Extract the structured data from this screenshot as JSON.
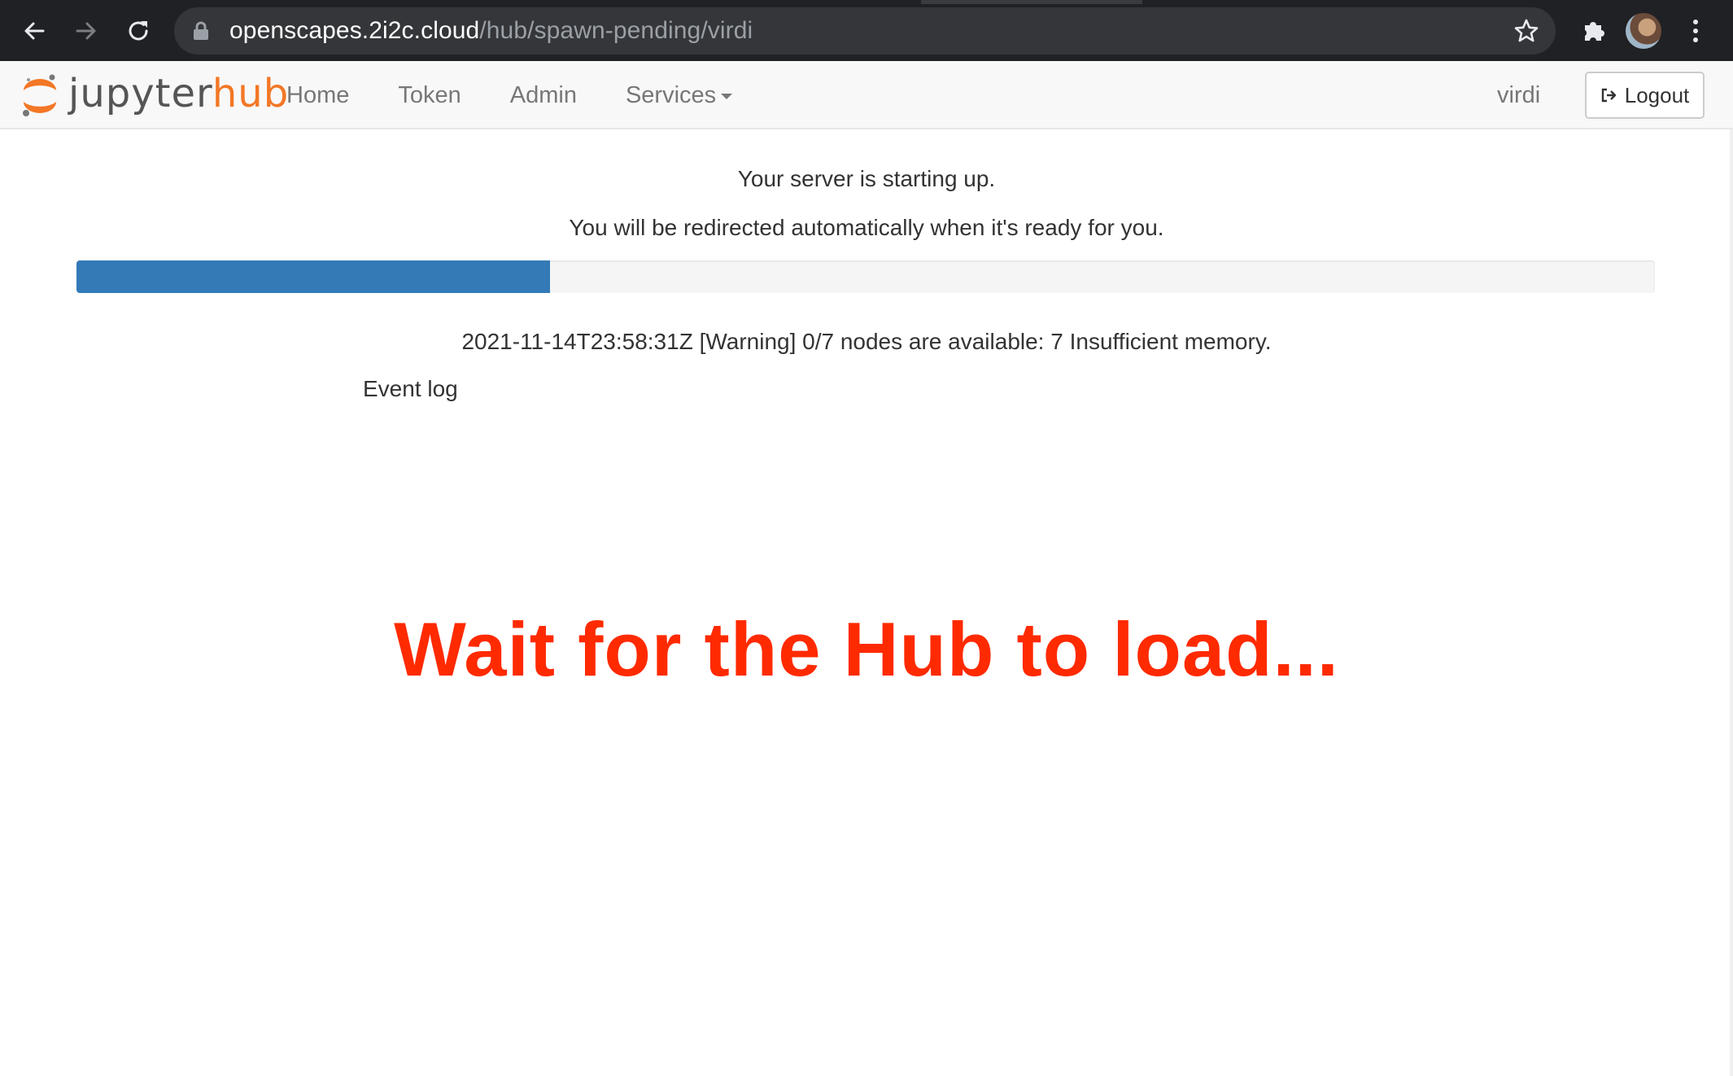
{
  "browser": {
    "url_host": "openscapes.2i2c.cloud",
    "url_path": "/hub/spawn-pending/virdi",
    "icons": [
      "back-arrow-icon",
      "forward-arrow-icon",
      "reload-icon",
      "lock-icon",
      "star-icon",
      "extensions-puzzle-icon",
      "profile-avatar",
      "more-vert-icon"
    ]
  },
  "navbar": {
    "logo_text_main": "jupyter",
    "logo_text_accent": "hub",
    "links": [
      "Home",
      "Token",
      "Admin",
      "Services"
    ],
    "user": "virdi",
    "logout_label": "Logout"
  },
  "main": {
    "starting_text": "Your server is starting up.",
    "redirect_text": "You will be redirected automatically when it's ready for you.",
    "progress_fraction": 0.3,
    "progress_message": "2021-11-14T23:58:31Z [Warning] 0/7 nodes are available: 7 Insufficient memory.",
    "event_log_label": "Event log",
    "overlay_text": "Wait for the Hub to load..."
  },
  "colors": {
    "chrome_bg": "#202124",
    "omnibox_bg": "#35363a",
    "accent_orange": "#f37726",
    "progress_blue": "#337ab7",
    "overlay_red": "#ff2a00"
  }
}
